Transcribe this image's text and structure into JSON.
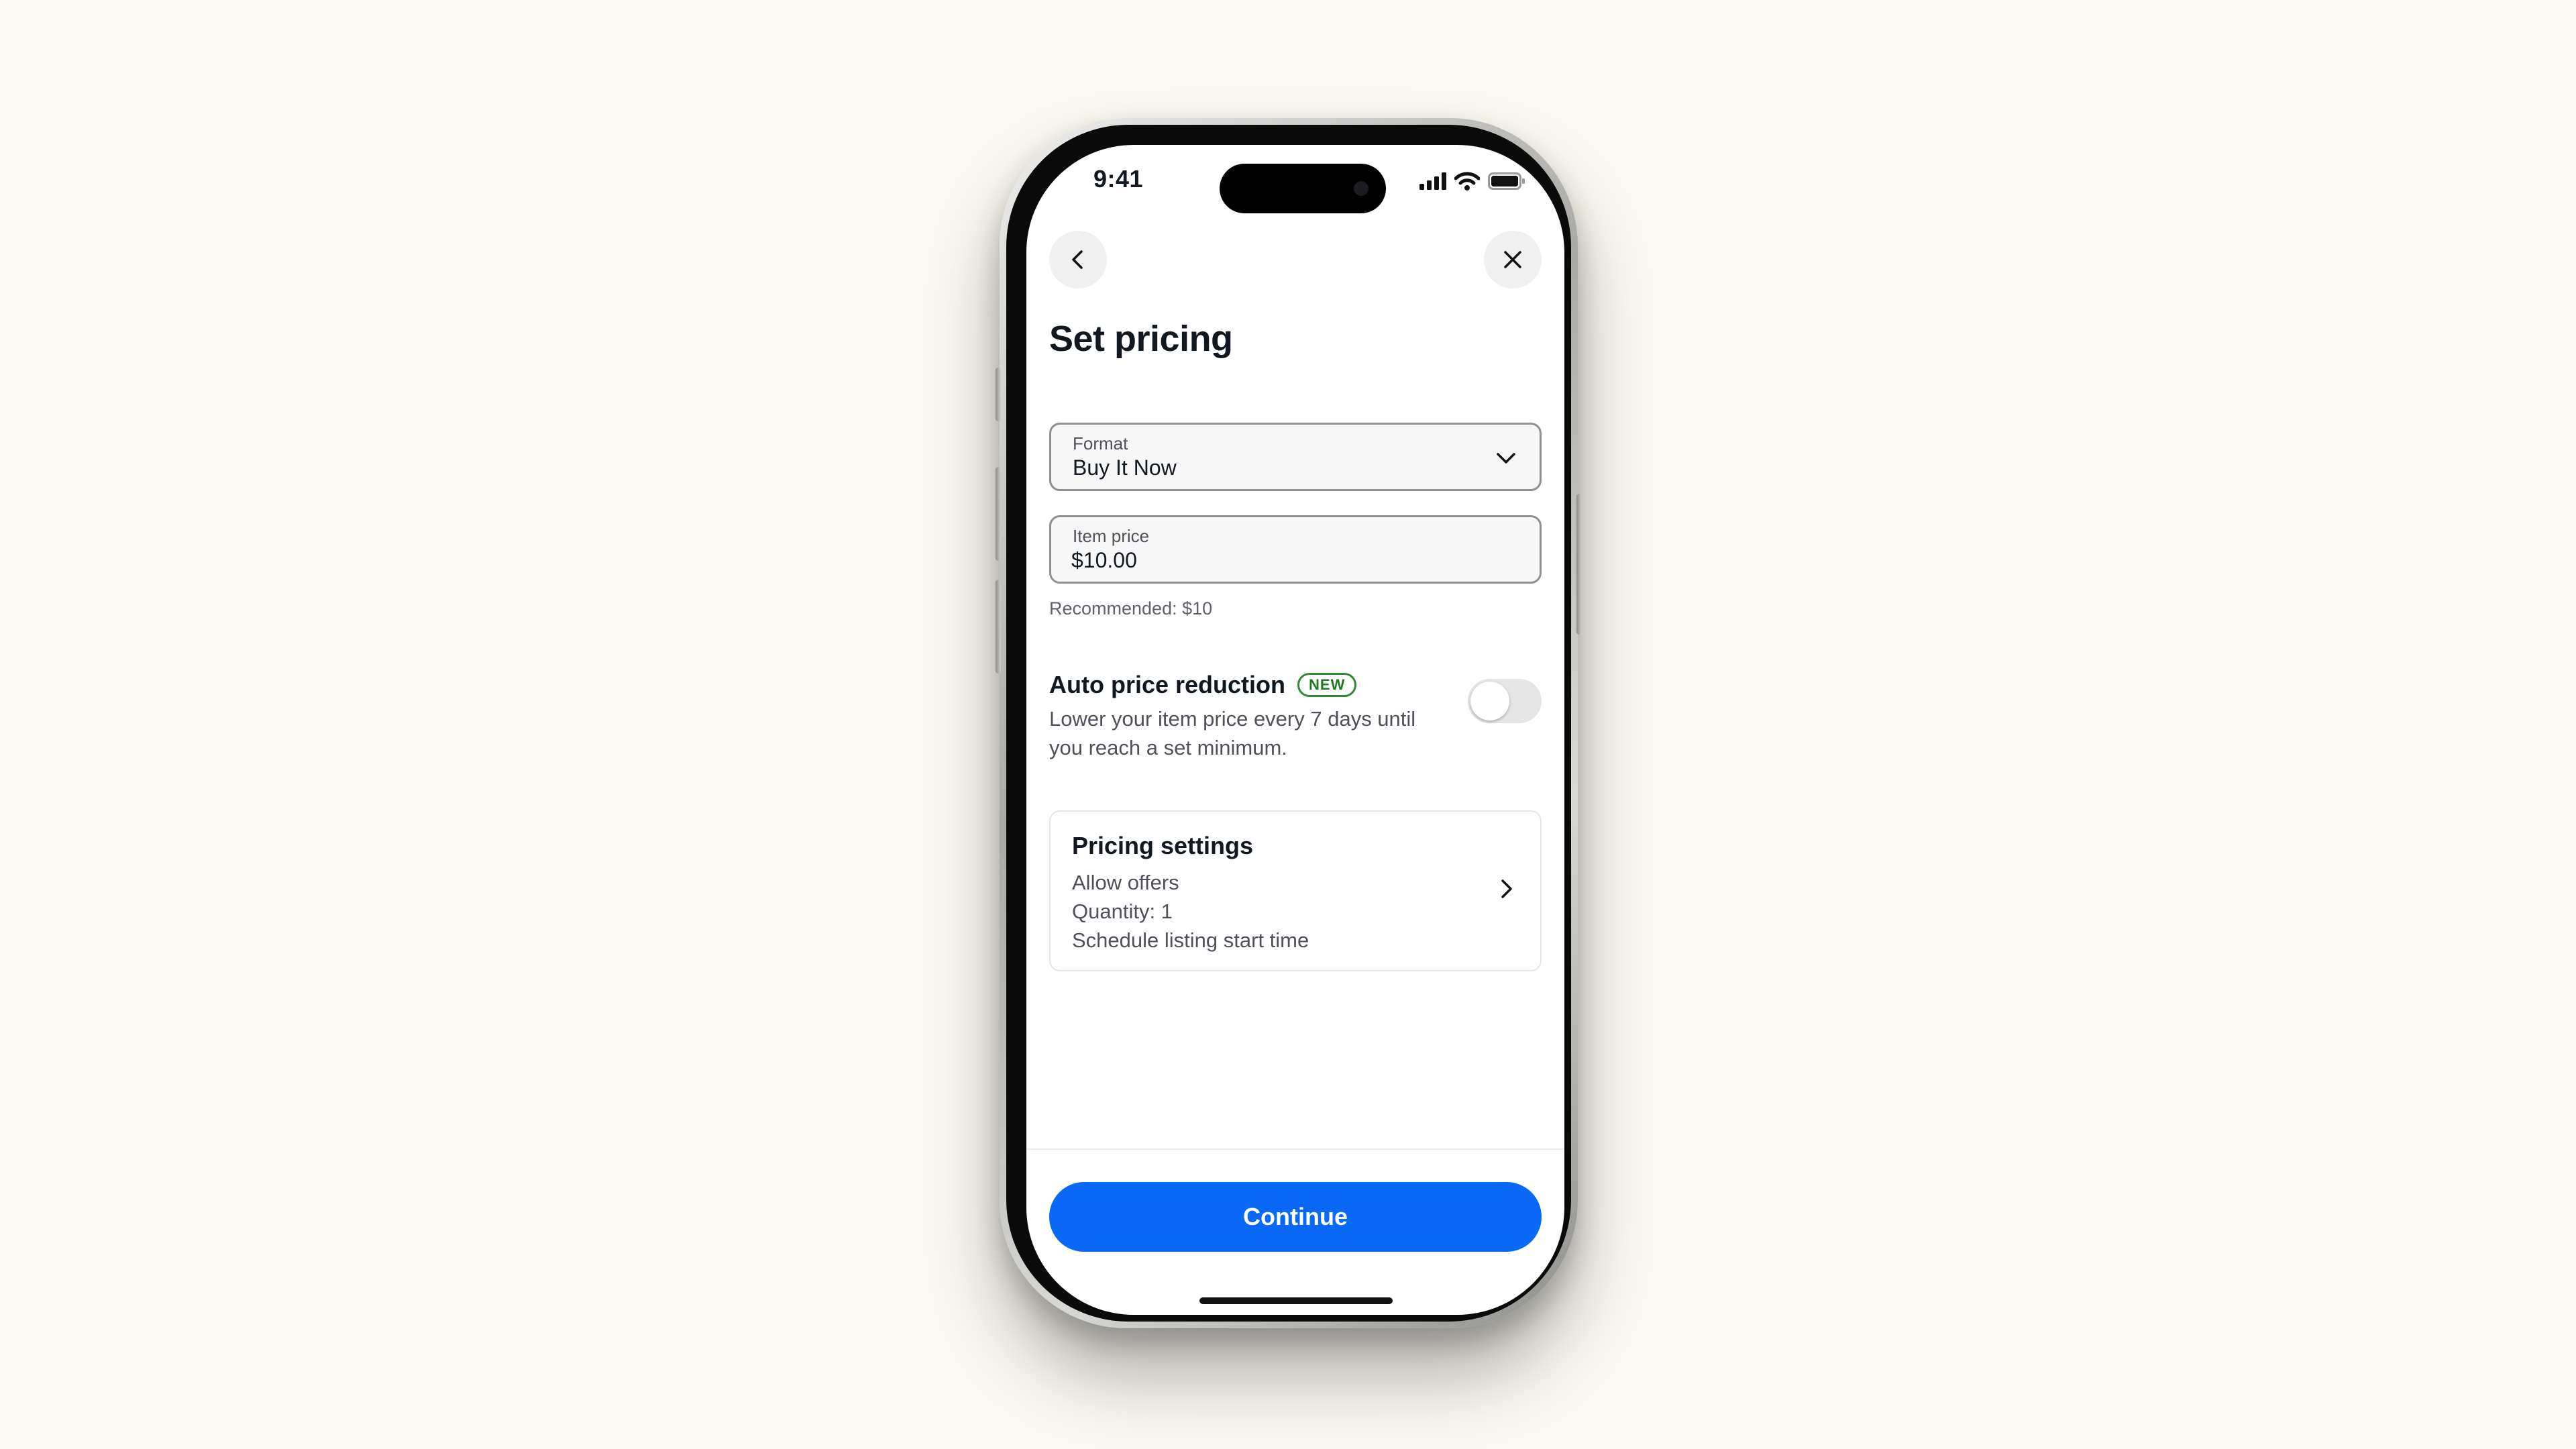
{
  "status_bar": {
    "time": "9:41",
    "icons": [
      "cellular-signal-icon",
      "wifi-icon",
      "battery-icon"
    ]
  },
  "nav": {
    "back_icon": "chevron-left-icon",
    "close_icon": "close-icon"
  },
  "page": {
    "title": "Set pricing"
  },
  "format_field": {
    "label": "Format",
    "value": "Buy It Now",
    "icon": "chevron-down-icon"
  },
  "price_field": {
    "label": "Item price",
    "value": "$10.00",
    "helper": "Recommended: $10"
  },
  "auto_price_reduction": {
    "title": "Auto price reduction",
    "badge": "NEW",
    "description": "Lower your item price every 7 days until you reach a set minimum.",
    "enabled": false
  },
  "pricing_settings": {
    "title": "Pricing settings",
    "lines": [
      "Allow offers",
      "Quantity: 1",
      "Schedule listing start time"
    ],
    "icon": "chevron-right-icon"
  },
  "footer": {
    "continue_label": "Continue"
  },
  "colors": {
    "background": "#fbf8f1",
    "primary": "#0968f6",
    "badge_green": "#2e8b2e",
    "text": "#111820",
    "muted_text": "#50505a"
  }
}
